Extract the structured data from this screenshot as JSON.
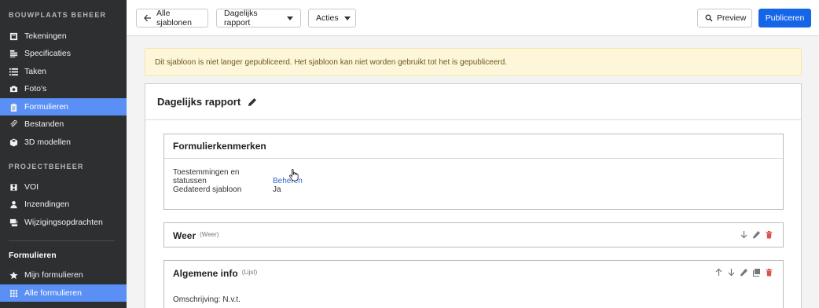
{
  "sidebar": {
    "heading_main": "BOUWPLAATS BEHEER",
    "items_main": [
      {
        "label": "Tekeningen",
        "icon": "drawings-icon"
      },
      {
        "label": "Specificaties",
        "icon": "specs-icon"
      },
      {
        "label": "Taken",
        "icon": "list-icon"
      },
      {
        "label": "Foto's",
        "icon": "camera-icon"
      },
      {
        "label": "Formulieren",
        "icon": "clipboard-icon"
      },
      {
        "label": "Bestanden",
        "icon": "paperclip-icon"
      },
      {
        "label": "3D modellen",
        "icon": "cube-icon"
      }
    ],
    "heading_project": "PROJECTBEHEER",
    "items_project": [
      {
        "label": "VOI",
        "icon": "question-icon"
      },
      {
        "label": "Inzendingen",
        "icon": "user-icon"
      },
      {
        "label": "Wijzigingsopdrachten",
        "icon": "layers-icon"
      }
    ],
    "section_title": "Formulieren",
    "items_forms": [
      {
        "label": "Mijn formulieren",
        "icon": "star-icon"
      },
      {
        "label": "Alle formulieren",
        "icon": "grid-icon"
      }
    ],
    "active_color": "#5a8ff5"
  },
  "toolbar": {
    "back_label": "Alle sjablonen",
    "report_label": "Dagelijks rapport",
    "actions_label": "Acties",
    "preview_label": "Preview",
    "publish_label": "Publiceren",
    "primary_color": "#1565e8"
  },
  "alert": {
    "text": "Dit sjabloon is niet langer gepubliceerd. Het sjabloon kan niet worden gebruikt tot het is gepubliceerd."
  },
  "card": {
    "title": "Dagelijks rapport",
    "properties_panel": {
      "title": "Formulierkenmerken",
      "rows": [
        {
          "key": "Toestemmingen en statussen",
          "value": "Beheren"
        },
        {
          "key": "Gedateerd sjabloon",
          "value": "Ja"
        }
      ]
    },
    "weather_panel": {
      "title": "Weer",
      "type": "(Weer)"
    },
    "general_panel": {
      "title": "Algemene info",
      "type": "(Lijst)",
      "description": "Omschrijving: N.v.t."
    }
  }
}
